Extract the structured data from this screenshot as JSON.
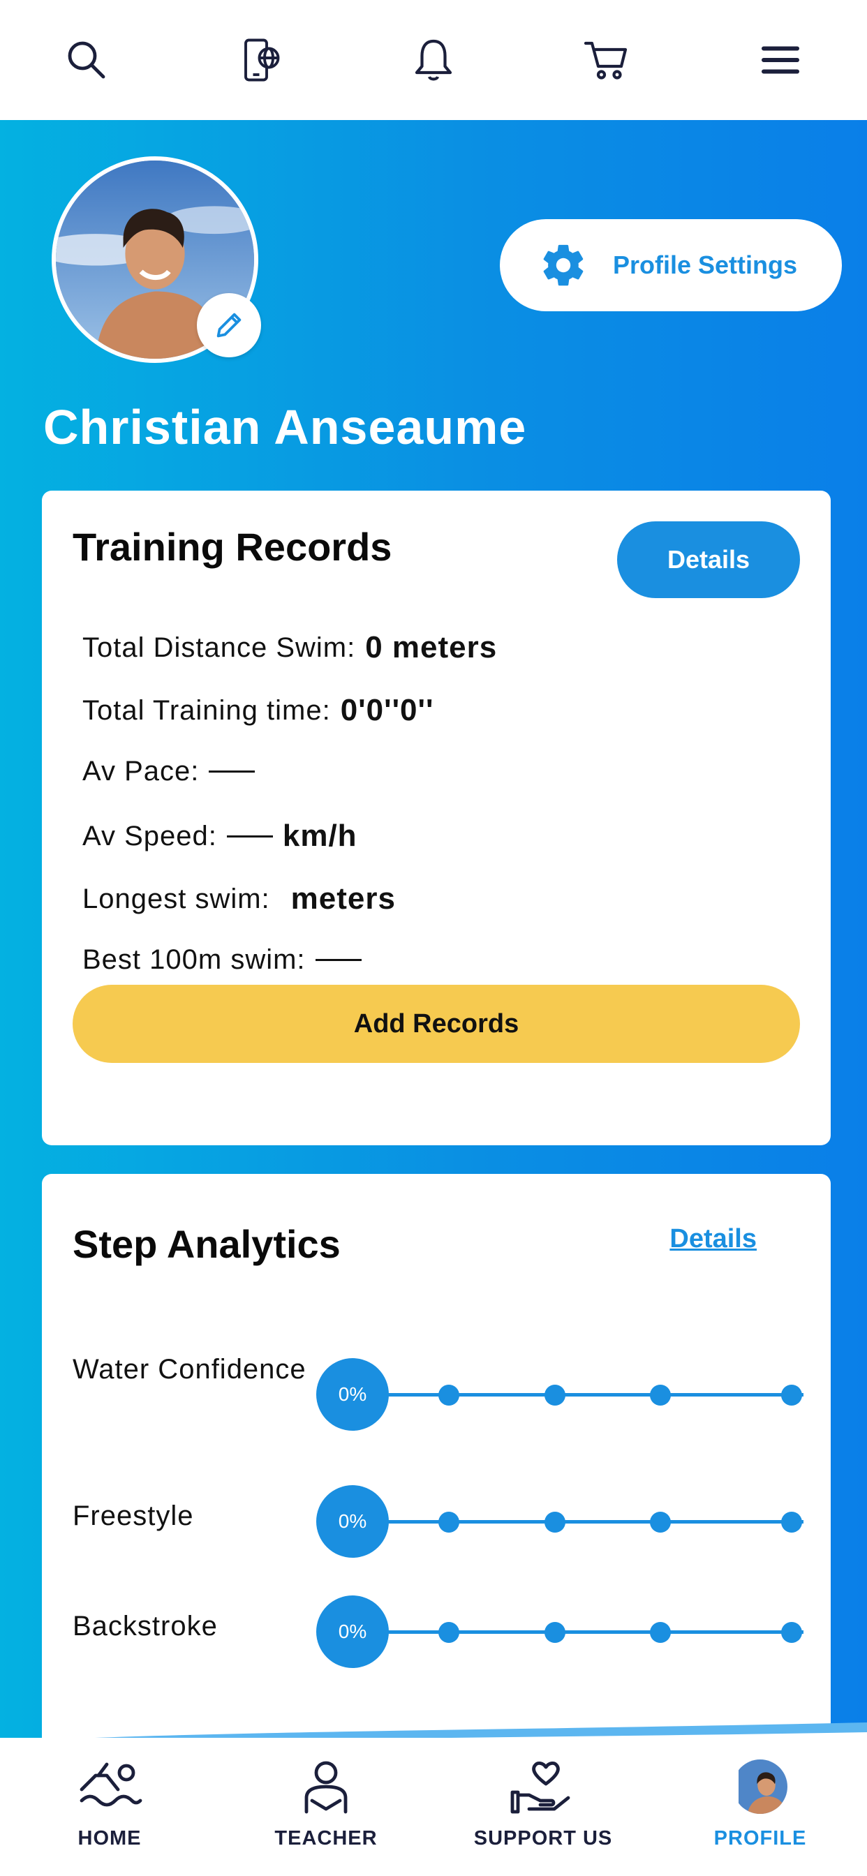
{
  "colors": {
    "primary": "#1a8fe0",
    "accent_yellow": "#f6ca50",
    "gradient_start": "#04b1e1",
    "gradient_end": "#0a7fe8",
    "nav_text": "#1b1f3b"
  },
  "topbar": {
    "icons": [
      "search-icon",
      "phone-globe-icon",
      "bell-icon",
      "cart-icon",
      "menu-icon"
    ]
  },
  "profile": {
    "name": "Christian Anseaume",
    "settings_label": "Profile Settings"
  },
  "training": {
    "title": "Training Records",
    "details_label": "Details",
    "rows": [
      {
        "label": "Total Distance Swim:",
        "value": "0 meters"
      },
      {
        "label": "Total Training time:",
        "value": "0'0''0''"
      },
      {
        "label": "Av Pace:",
        "value": ""
      },
      {
        "label": "Av Speed:",
        "value": "km/h"
      },
      {
        "label": "Longest swim:",
        "value": "meters"
      },
      {
        "label": "Best 100m swim:",
        "value": ""
      }
    ],
    "add_label": "Add Records"
  },
  "steps": {
    "title": "Step Analytics",
    "details_label": "Details",
    "skills": [
      {
        "label": "Water Confidence",
        "progress": "0%"
      },
      {
        "label": "Freestyle",
        "progress": "0%"
      },
      {
        "label": "Backstroke",
        "progress": "0%"
      }
    ]
  },
  "nav": {
    "items": [
      {
        "label": "HOME",
        "icon": "swimmer-icon"
      },
      {
        "label": "TEACHER",
        "icon": "teacher-icon"
      },
      {
        "label": "SUPPORT US",
        "icon": "heart-hand-icon"
      },
      {
        "label": "PROFILE",
        "icon": "avatar",
        "active": true
      }
    ]
  }
}
